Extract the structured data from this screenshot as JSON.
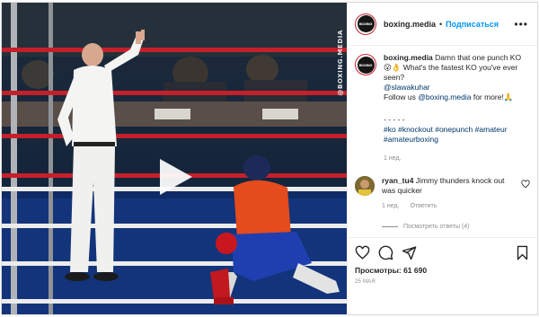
{
  "post": {
    "watermark": "@BOXING.MEDIA",
    "header": {
      "username": "boxing.media",
      "avatar_text": "BOXING",
      "separator": "•",
      "follow_label": "Подписаться",
      "more_label": "•••"
    },
    "caption": {
      "username": "boxing.media",
      "line1": " Damn that one punch KO 😮👌 What's the fastest KO you've ever seen?",
      "mention": "@slawakuhar",
      "follow_text_pre": "Follow us ",
      "follow_handle": "@boxing.media",
      "follow_text_post": " for more!🙏",
      "dashes": "- - - - -",
      "hashtags": [
        "#ko",
        "#knockout",
        "#onepunch",
        "#amateur",
        "#amateurboxing"
      ],
      "time": "1 нед."
    },
    "comment": {
      "username": "ryan_tu4",
      "text": " Jimmy thunders knock out was quicker",
      "time": "1 нед.",
      "reply_label": "Ответить",
      "replies_label": "Посмотреть ответы (4)"
    },
    "stats": {
      "views_label": "Просмотры: 61 690",
      "date": "25 МАЯ"
    },
    "icons": [
      "heart-icon",
      "comment-icon",
      "share-icon",
      "bookmark-icon",
      "play-icon"
    ]
  }
}
